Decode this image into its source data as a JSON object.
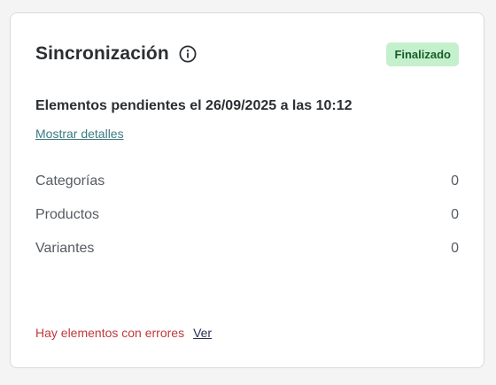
{
  "sync": {
    "title": "Sincronización",
    "status_badge": "Finalizado",
    "pending_text": "Elementos pendientes el 26/09/2025 a las 10:12",
    "details_link": "Mostrar detalles",
    "rows": [
      {
        "label": "Categorías",
        "value": "0"
      },
      {
        "label": "Productos",
        "value": "0"
      },
      {
        "label": "Variantes",
        "value": "0"
      }
    ],
    "error_text": "Hay elementos con errores",
    "view_link": "Ver"
  },
  "icons": {
    "info": "info-icon"
  },
  "colors": {
    "badge_bg": "#c5f0cd",
    "badge_text": "#195c2a",
    "error": "#c0393b",
    "link": "#3c7a80"
  }
}
